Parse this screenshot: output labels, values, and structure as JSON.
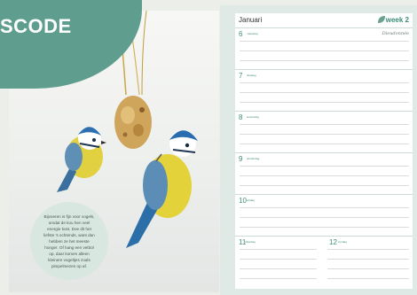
{
  "brand": {
    "logo_text": "SCODE"
  },
  "caption": {
    "text": "Bijvoeren is fijn voor vogels, omdat de kou hen veel energie kost. Doe dit het liefste 's ochtends, want dan hebben ze het meeste honger. Of hang een vetbol op, daar komen alleen kleinere vogeltjes zoals pimpelmezen op af."
  },
  "planner": {
    "month": "Januari",
    "week": "week 2",
    "note": "Dieudonnée",
    "days": [
      {
        "num": "6",
        "name": "maandag"
      },
      {
        "num": "7",
        "name": "dinsdag"
      },
      {
        "num": "8",
        "name": "woensdag"
      },
      {
        "num": "9",
        "name": "donderdag"
      },
      {
        "num": "10",
        "name": "vrijdag"
      },
      {
        "num": "11",
        "name": "zaterdag"
      },
      {
        "num": "12",
        "name": "zondag"
      }
    ]
  },
  "colors": {
    "accent": "#5f9e8e",
    "accent_text": "#3d8c78",
    "bird_yellow": "#e4d23a",
    "bird_blue": "#2c6ea8"
  }
}
